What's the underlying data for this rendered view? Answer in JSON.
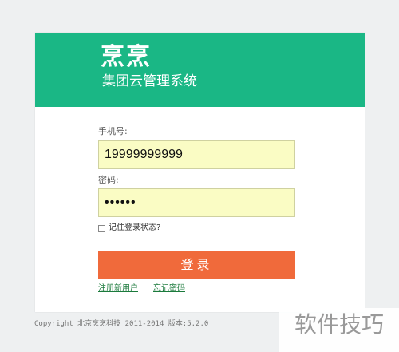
{
  "brand": {
    "logo_text": "烹烹",
    "subtitle": "集团云管理系统"
  },
  "form": {
    "phone_label": "手机号:",
    "phone_value": "19999999999",
    "password_label": "密码:",
    "password_value": "••••••",
    "remember_label": "记住登录状态?",
    "remember_checked": false,
    "login_button": "登录"
  },
  "links": {
    "register": "注册新用户",
    "forgot": "忘记密码"
  },
  "footer": {
    "copyright": "Copyright 北京烹烹科技 2011-2014 版本:5.2.0"
  },
  "overlay": {
    "watermark": "软件技巧"
  },
  "colors": {
    "banner": "#1ab785",
    "button": "#f06a3b",
    "input_bg": "#fafcc4",
    "link": "#1b7a3c"
  }
}
